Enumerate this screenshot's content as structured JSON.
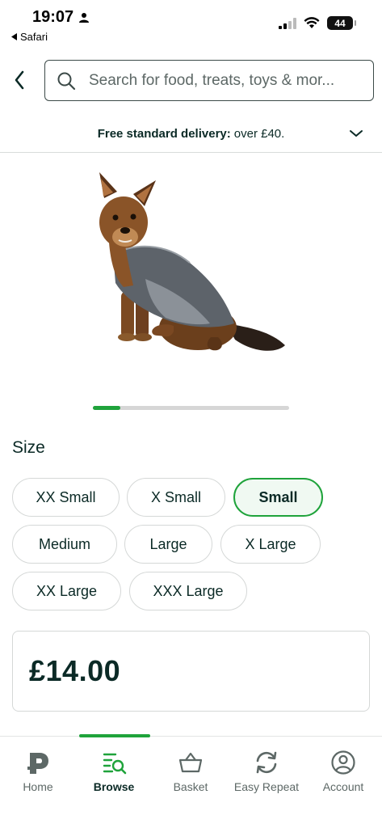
{
  "status_bar": {
    "time": "19:07",
    "back_app_label": "Safari",
    "battery": "44"
  },
  "search": {
    "placeholder": "Search for food, treats, toys & mor..."
  },
  "delivery": {
    "bold": "Free standard delivery:",
    "rest": "over £40."
  },
  "carousel": {
    "progress": 0.14
  },
  "size": {
    "label": "Size",
    "options": [
      "XX Small",
      "X Small",
      "Small",
      "Medium",
      "Large",
      "X Large",
      "XX Large",
      "XXX Large"
    ],
    "selected": "Small"
  },
  "price": "£14.00",
  "tabs": [
    {
      "label": "Home",
      "icon": "home-logo-icon"
    },
    {
      "label": "Browse",
      "icon": "browse-icon",
      "active": true
    },
    {
      "label": "Basket",
      "icon": "basket-icon"
    },
    {
      "label": "Easy Repeat",
      "icon": "repeat-icon"
    },
    {
      "label": "Account",
      "icon": "account-icon"
    }
  ],
  "colors": {
    "accent": "#1fa33b",
    "text": "#0b2a26"
  }
}
